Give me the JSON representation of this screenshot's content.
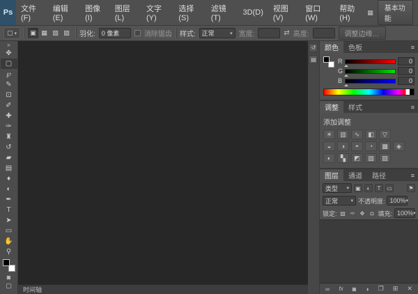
{
  "ui": {
    "caret": "▾"
  },
  "menubar": {
    "logo": "Ps",
    "items": [
      "文件(F)",
      "编辑(E)",
      "图像(I)",
      "图层(L)",
      "文字(Y)",
      "选择(S)",
      "滤镜(T)",
      "3D(D)",
      "视图(V)",
      "窗口(W)",
      "帮助(H)"
    ],
    "arrange_icon": "▦",
    "workspace": "基本功能"
  },
  "options": {
    "tool_icon": "▢",
    "modes": [
      {
        "name": "new-selection-icon",
        "glyph": "▣"
      },
      {
        "name": "add-to-selection-icon",
        "glyph": "▦"
      },
      {
        "name": "subtract-from-selection-icon",
        "glyph": "▧"
      },
      {
        "name": "intersect-selection-icon",
        "glyph": "▨"
      }
    ],
    "feather_label": "羽化:",
    "feather_value": "0 像素",
    "antialias_label": "消除锯齿",
    "style_label": "样式:",
    "style_value": "正常",
    "width_label": "宽度:",
    "width_value": "",
    "swap_icon": "⇄",
    "height_label": "高度:",
    "height_value": "",
    "refine_edge_label": "调整边缘…"
  },
  "toolbar": {
    "collapse_icon": "»",
    "tools": [
      {
        "name": "move-tool",
        "glyph": "✥"
      },
      {
        "name": "rectangular-marquee-tool",
        "glyph": "▢"
      },
      {
        "name": "lasso-tool",
        "glyph": "℘"
      },
      {
        "name": "quick-selection-tool",
        "glyph": "✎"
      },
      {
        "name": "crop-tool",
        "glyph": "⊡"
      },
      {
        "name": "eyedropper-tool",
        "glyph": "✐"
      },
      {
        "name": "spot-healing-brush-tool",
        "glyph": "✚"
      },
      {
        "name": "brush-tool",
        "glyph": "✑"
      },
      {
        "name": "clone-stamp-tool",
        "glyph": "♜"
      },
      {
        "name": "history-brush-tool",
        "glyph": "↺"
      },
      {
        "name": "eraser-tool",
        "glyph": "▰"
      },
      {
        "name": "gradient-tool",
        "glyph": "▤"
      },
      {
        "name": "blur-tool",
        "glyph": "♦"
      },
      {
        "name": "dodge-tool",
        "glyph": "◐"
      },
      {
        "name": "pen-tool",
        "glyph": "✒"
      },
      {
        "name": "type-tool",
        "glyph": "T"
      },
      {
        "name": "path-selection-tool",
        "glyph": "➤"
      },
      {
        "name": "shape-tool",
        "glyph": "▭"
      },
      {
        "name": "hand-tool",
        "glyph": "✋"
      },
      {
        "name": "zoom-tool",
        "glyph": "⚲"
      }
    ],
    "quick_mask_icon": "◙",
    "screen_mode_icon": "▢"
  },
  "dock": {
    "buttons": [
      {
        "name": "collapsed-history-panel-button",
        "glyph": "↺"
      },
      {
        "name": "collapsed-properties-panel-button",
        "glyph": "▤"
      }
    ]
  },
  "color_panel": {
    "tabs": [
      "颜色",
      "色板"
    ],
    "menu_icon": "≡",
    "channels": [
      {
        "label": "R",
        "value": "0"
      },
      {
        "label": "G",
        "value": "0"
      },
      {
        "label": "B",
        "value": "0"
      }
    ]
  },
  "adjustments_panel": {
    "tabs": [
      "调整",
      "样式"
    ],
    "menu_icon": "≡",
    "header": "添加调整",
    "icons": [
      {
        "name": "adj-brightness-contrast-icon",
        "glyph": "☀"
      },
      {
        "name": "adj-levels-icon",
        "glyph": "▥"
      },
      {
        "name": "adj-curves-icon",
        "glyph": "∿"
      },
      {
        "name": "adj-exposure-icon",
        "glyph": "◧"
      },
      {
        "name": "adj-vibrance-icon",
        "glyph": "▽"
      },
      {
        "name": "adj-hue-saturation-icon",
        "glyph": "◒"
      },
      {
        "name": "adj-color-balance-icon",
        "glyph": "◑"
      },
      {
        "name": "adj-black-white-icon",
        "glyph": "◓"
      },
      {
        "name": "adj-photo-filter-icon",
        "glyph": "◔"
      },
      {
        "name": "adj-channel-mixer-icon",
        "glyph": "▩"
      },
      {
        "name": "adj-color-lookup-icon",
        "glyph": "◈"
      },
      {
        "name": "adj-invert-icon",
        "glyph": "◐"
      },
      {
        "name": "adj-posterize-icon",
        "glyph": "▚"
      },
      {
        "name": "adj-threshold-icon",
        "glyph": "◩"
      },
      {
        "name": "adj-gradient-map-icon",
        "glyph": "▧"
      },
      {
        "name": "adj-selective-color-icon",
        "glyph": "▨"
      }
    ]
  },
  "layers_panel": {
    "tabs": [
      "图层",
      "通道",
      "路径"
    ],
    "menu_icon": "≡",
    "filter_label": "类型",
    "filter_icons": [
      {
        "name": "filter-pixel-layers-icon",
        "glyph": "▣"
      },
      {
        "name": "filter-adjustment-layers-icon",
        "glyph": "◐"
      },
      {
        "name": "filter-type-layers-icon",
        "glyph": "T"
      },
      {
        "name": "filter-shape-layers-icon",
        "glyph": "▭"
      },
      {
        "name": "filter-smart-objects-icon",
        "glyph": "⊡"
      }
    ],
    "filter_toggle_icon": "⚑",
    "blend_mode": "正常",
    "opacity_label": "不透明度:",
    "opacity_value": "100%",
    "lock_label": "锁定:",
    "lock_icons": [
      {
        "name": "lock-transparency-icon",
        "glyph": "▨"
      },
      {
        "name": "lock-pixels-icon",
        "glyph": "✑"
      },
      {
        "name": "lock-position-icon",
        "glyph": "✥"
      },
      {
        "name": "lock-all-icon",
        "glyph": "◘"
      }
    ],
    "fill_label": "填充:",
    "fill_value": "100%",
    "bottom_icons": [
      {
        "name": "link-layers-icon",
        "glyph": "∞"
      },
      {
        "name": "layer-effects-icon",
        "glyph": "fx"
      },
      {
        "name": "add-layer-mask-icon",
        "glyph": "◙"
      },
      {
        "name": "new-adjustment-layer-icon",
        "glyph": "◑"
      },
      {
        "name": "new-group-icon",
        "glyph": "❐"
      },
      {
        "name": "new-layer-icon",
        "glyph": "⊞"
      },
      {
        "name": "delete-layer-icon",
        "glyph": "✕"
      }
    ]
  },
  "timeline": {
    "tab": "时间轴"
  }
}
